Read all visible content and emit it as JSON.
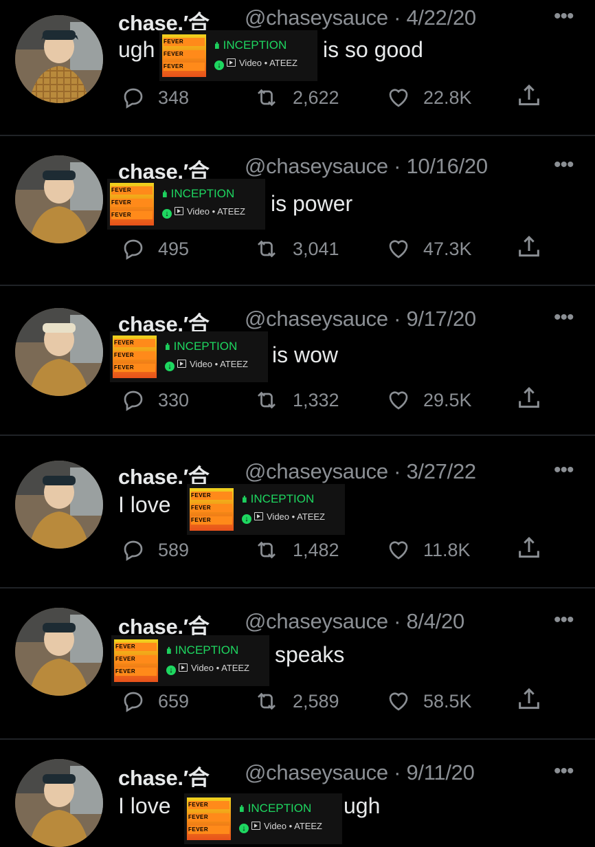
{
  "tweets": [
    {
      "name": "chase.′合",
      "handle": "@chaseysauce",
      "date": "· 4/22/20",
      "text_before": "ugh",
      "text_after": "is so good",
      "replies": "348",
      "retweets": "2,622",
      "likes": "22.8K"
    },
    {
      "name": "chase.′合",
      "handle": "@chaseysauce",
      "date": "· 10/16/20",
      "text_before": "",
      "text_after": "is power",
      "replies": "495",
      "retweets": "3,041",
      "likes": "47.3K"
    },
    {
      "name": "chase.′合",
      "handle": "@chaseysauce",
      "date": "· 9/17/20",
      "text_before": "",
      "text_after": "is wow",
      "replies": "330",
      "retweets": "1,332",
      "likes": "29.5K"
    },
    {
      "name": "chase.′合",
      "handle": "@chaseysauce",
      "date": "· 3/27/22",
      "text_before": "I love",
      "text_after": "",
      "replies": "589",
      "retweets": "1,482",
      "likes": "11.8K"
    },
    {
      "name": "chase.′合",
      "handle": "@chaseysauce",
      "date": "· 8/4/20",
      "text_before": "",
      "text_after": "speaks",
      "replies": "659",
      "retweets": "2,589",
      "likes": "58.5K"
    },
    {
      "name": "chase.′合",
      "handle": "@chaseysauce",
      "date": "· 9/11/20",
      "text_before": "I love",
      "text_after": "ugh",
      "replies": "",
      "retweets": "",
      "likes": ""
    }
  ],
  "card": {
    "title": "INCEPTION",
    "subtitle": "Video • ATEEZ",
    "cover_text": "FEVER"
  },
  "more_label": "•••",
  "colors": {
    "accent": "#1ed760",
    "muted": "#8b8f94",
    "text": "#e7e9ea",
    "bg": "#000000"
  },
  "icons": {
    "reply": "reply-icon",
    "retweet": "retweet-icon",
    "like": "heart-icon",
    "share": "share-icon"
  }
}
